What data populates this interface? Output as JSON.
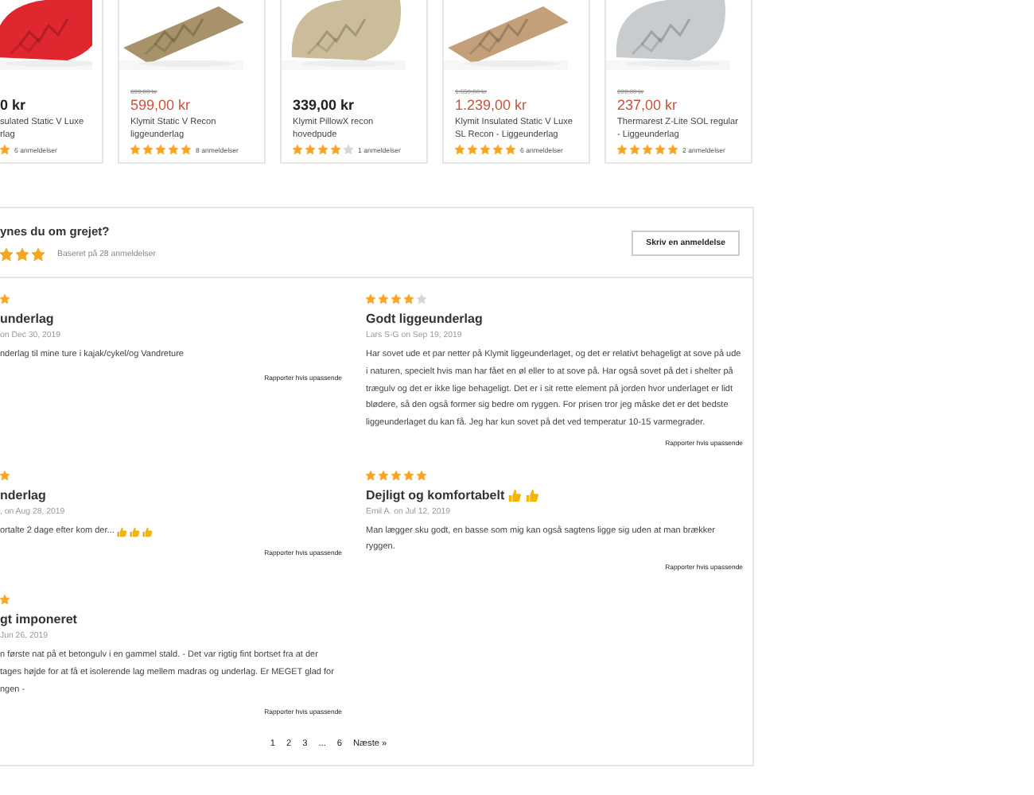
{
  "products": [
    {
      "kind": "cut",
      "price": "0 kr",
      "sale": false,
      "name": "sulated Static V Luxe\nrlag",
      "rating": {
        "kind": "cut",
        "shown": [
          {
            "filled": true
          }
        ]
      },
      "reviews": "6 anmeldelser"
    },
    {
      "kind": "full",
      "old_price": "699,00 kr",
      "price": "599,00 kr",
      "sale": true,
      "name": "Klymit Static V Recon liggeunderlag",
      "rating": {
        "kind": "full",
        "stars": 5
      },
      "reviews": "8 anmeldelser"
    },
    {
      "kind": "full",
      "price": "339,00 kr",
      "sale": false,
      "name": "Klymit PillowX recon hovedpude",
      "rating": {
        "kind": "full",
        "stars": 4
      },
      "reviews": "1 anmeldelser"
    },
    {
      "kind": "full",
      "old_price": "1.550,00 kr",
      "price": "1.239,00 kr",
      "sale": true,
      "name": "Klymit Insulated Static V Luxe SL Recon - Liggeunderlag",
      "rating": {
        "kind": "full",
        "stars": 5
      },
      "reviews": "6 anmeldelser"
    },
    {
      "kind": "full",
      "old_price": "299,00 kr",
      "price": "237,00 kr",
      "sale": true,
      "name": "Thermarest Z-Lite SOL regular - Liggeunderlag",
      "rating": {
        "kind": "full",
        "stars": 5
      },
      "reviews": "2 anmeldelser"
    }
  ],
  "reviews_panel": {
    "title": "ynes du om grejet?",
    "rating": {
      "kind": "cut",
      "shown": [
        {
          "filled": true
        },
        {
          "filled": true
        },
        {
          "filled": true
        }
      ]
    },
    "summary": "Baseret på 28 anmeldelser",
    "write_button": "Skriv en anmeldelse",
    "reviews": [
      {
        "rating": {
          "kind": "cut",
          "shown": [
            {
              "filled": true
            }
          ]
        },
        "title": "underlag",
        "meta": "on Dec 30, 2019",
        "body": "nderlag til mine ture i kajak/cykel/og Vandreture",
        "report": "Rapporter hvis upassende"
      },
      {
        "rating": {
          "kind": "full",
          "stars": 4
        },
        "title": "Godt liggeunderlag",
        "meta": "Lars S-G on Sep 19, 2019",
        "body": "Har sovet ude et par netter på Klymit liggeunderlaget, og det er relativt behageligt at sove på ude i naturen, specielt hvis man har fået en øl eller to at sove på. Har også sovet på det i shelter på trægulv og det er ikke lige behageligt. Det er i sit rette element på jorden hvor underlaget er lidt blødere, så den også former sig bedre om ryggen. For prisen tror jeg måske det er det bedste liggeunderlaget du kan få. Jeg har kun sovet på det ved temperatur 10-15 varmegrader.",
        "report": "Rapporter hvis upassende"
      },
      {
        "rating": {
          "kind": "cut",
          "shown": [
            {
              "filled": true
            }
          ]
        },
        "title": "nderlag",
        "meta": ", on Aug 28, 2019",
        "body": "ortalte 2 dage efter kom der...",
        "body_icons": [
          {
            "kind": "thumbs-up"
          },
          {
            "kind": "thumbs-up"
          },
          {
            "kind": "thumbs-up"
          }
        ],
        "report": "Rapporter hvis upassende"
      },
      {
        "rating": {
          "kind": "full",
          "stars": 5
        },
        "title": "Dejligt og komfortabelt",
        "title_icons": [
          {
            "kind": "thumbs-up"
          },
          {
            "kind": "thumbs-up"
          }
        ],
        "meta": "Emil A. on Jul 12, 2019",
        "body": "Man lægger sku godt, en basse som mig kan også sagtens ligge sig uden at man brækker ryggen.",
        "report": "Rapporter hvis upassende"
      },
      {
        "rating": {
          "kind": "cut",
          "shown": [
            {
              "filled": true
            }
          ]
        },
        "title": "gt imponeret",
        "meta": "Jun 26, 2019",
        "body": "n første nat på et betongulv i en gammel stald. - Det var rigtig fint bortset fra at der\ntages højde for at få et isolerende lag mellem madras og underlag. Er MEGET glad for\nngen -",
        "report": "Rapporter hvis upassende"
      }
    ],
    "pagination": [
      "1",
      "2",
      "3",
      "...",
      "6",
      "Næste »"
    ]
  }
}
